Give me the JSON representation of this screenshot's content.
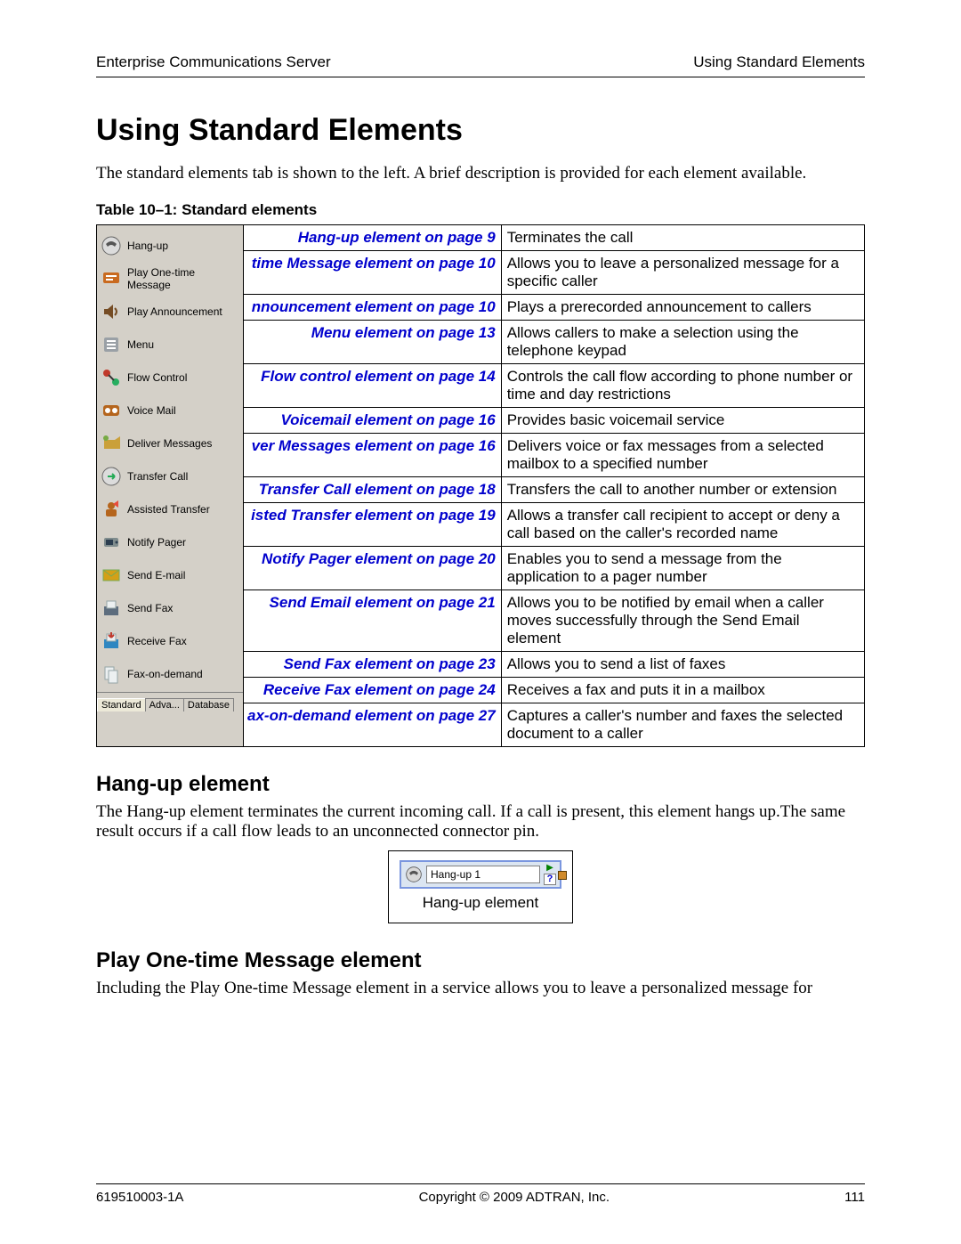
{
  "header": {
    "left": "Enterprise Communications Server",
    "right": "Using Standard Elements"
  },
  "title": "Using Standard Elements",
  "intro": "The standard elements tab is shown to the left. A brief description is provided for each element available.",
  "table_caption": "Table 10–1:  Standard elements",
  "sidebar": {
    "items": [
      {
        "label": "Hang-up",
        "icon": "phone"
      },
      {
        "label": "Play One-time Message",
        "icon": "msg"
      },
      {
        "label": "Play Announcement",
        "icon": "speaker"
      },
      {
        "label": "Menu",
        "icon": "menu"
      },
      {
        "label": "Flow Control",
        "icon": "flow"
      },
      {
        "label": "Voice Mail",
        "icon": "vmail"
      },
      {
        "label": "Deliver Messages",
        "icon": "deliver"
      },
      {
        "label": "Transfer Call",
        "icon": "transfer"
      },
      {
        "label": "Assisted Transfer",
        "icon": "assist"
      },
      {
        "label": "Notify Pager",
        "icon": "pager"
      },
      {
        "label": "Send E-mail",
        "icon": "email"
      },
      {
        "label": "Send Fax",
        "icon": "fax"
      },
      {
        "label": "Receive Fax",
        "icon": "rfax"
      },
      {
        "label": "Fax-on-demand",
        "icon": "fod"
      }
    ],
    "tabs": {
      "active": "Standard",
      "others": [
        "Adva...",
        "Database"
      ]
    }
  },
  "rows": [
    {
      "link": "Hang-up element on page 9",
      "desc": "Terminates the call"
    },
    {
      "link": "time Message element on page 10",
      "desc": "Allows you to leave a personalized message for a specific caller"
    },
    {
      "link": "nnouncement element on page 10",
      "desc": "Plays a prerecorded announcement to callers"
    },
    {
      "link": "Menu element on page 13",
      "desc": "Allows callers to make a selection using the telephone keypad"
    },
    {
      "link": "Flow control element on page 14",
      "desc": "Controls the call flow according to phone number or time and day restrictions"
    },
    {
      "link": "Voicemail element on page 16",
      "desc": "Provides basic voicemail service"
    },
    {
      "link": "ver Messages element on page 16",
      "desc": "Delivers voice or fax messages from a selected mailbox to a specified number"
    },
    {
      "link": "Transfer Call element on page 18",
      "desc": "Transfers the call to another number or extension"
    },
    {
      "link": "isted Transfer element on page 19",
      "desc": "Allows a transfer call recipient to accept or deny a call based on the caller's recorded name"
    },
    {
      "link": "Notify Pager element on page 20",
      "desc": "Enables you to send a message from the application to a pager number"
    },
    {
      "link": "Send Email element on page 21",
      "desc": "Allows you to be notified by email when a caller moves successfully through the Send Email element"
    },
    {
      "link": "Send Fax element on page 23",
      "desc": "Allows you to send a list of faxes"
    },
    {
      "link": "Receive Fax element on page 24",
      "desc": "Receives a fax and puts it in a mailbox"
    },
    {
      "link": "ax-on-demand element on page 27",
      "desc": "Captures a caller's number and faxes the selected document to a caller"
    }
  ],
  "section_hangup": {
    "title": "Hang-up element",
    "body": "The Hang-up element terminates the current incoming call. If a call is present, this element hangs up.The same result occurs if a call flow leads to an unconnected connector pin.",
    "widget_label": "Hang-up 1",
    "caption": "Hang-up element"
  },
  "section_play": {
    "title": "Play One-time Message element",
    "body": "Including the Play One-time Message element in a service allows you to leave a personalized message for"
  },
  "footer": {
    "left": "619510003-1A",
    "center": "Copyright © 2009 ADTRAN, Inc.",
    "right": "111"
  }
}
